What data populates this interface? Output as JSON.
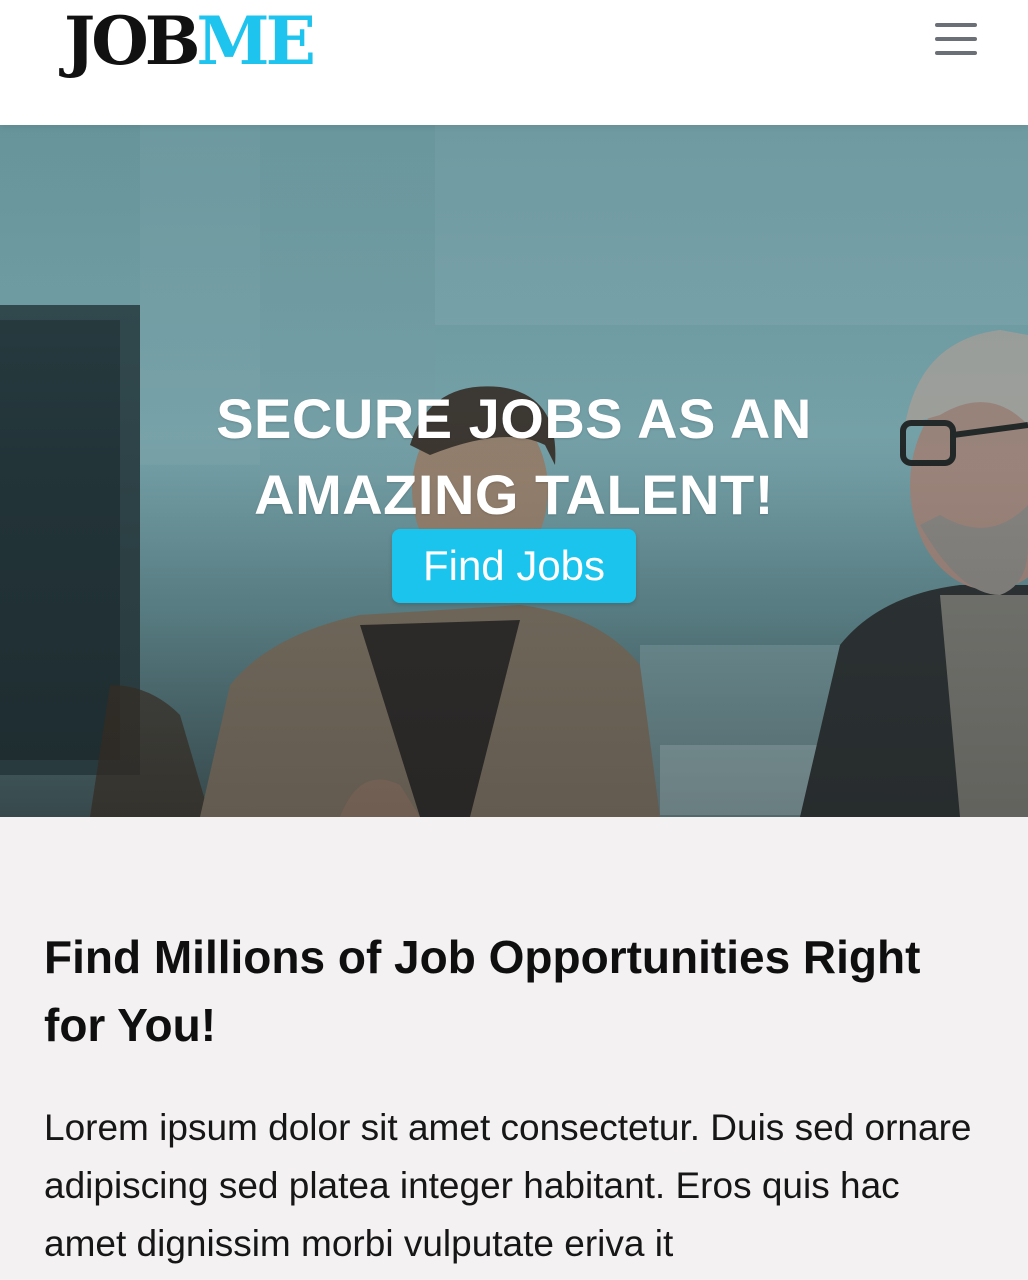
{
  "header": {
    "logo_part1": "JOB",
    "logo_part2": "ME",
    "menu_icon": "hamburger-menu-icon"
  },
  "hero": {
    "title": "SECURE JOBS AS AN AMAZING TALENT!",
    "cta_label": "Find Jobs"
  },
  "content": {
    "heading": "Find Millions of Job Opportunities Right for You!",
    "body": "Lorem ipsum dolor sit amet consectetur. Duis sed ornare adipiscing sed platea integer habitant. Eros quis hac amet dignissim morbi vulputate eriva it"
  },
  "colors": {
    "accent": "#1ac4ec",
    "logo_dark": "#111111",
    "menu_icon": "#6b7077",
    "section_bg": "#f3f1f2"
  }
}
